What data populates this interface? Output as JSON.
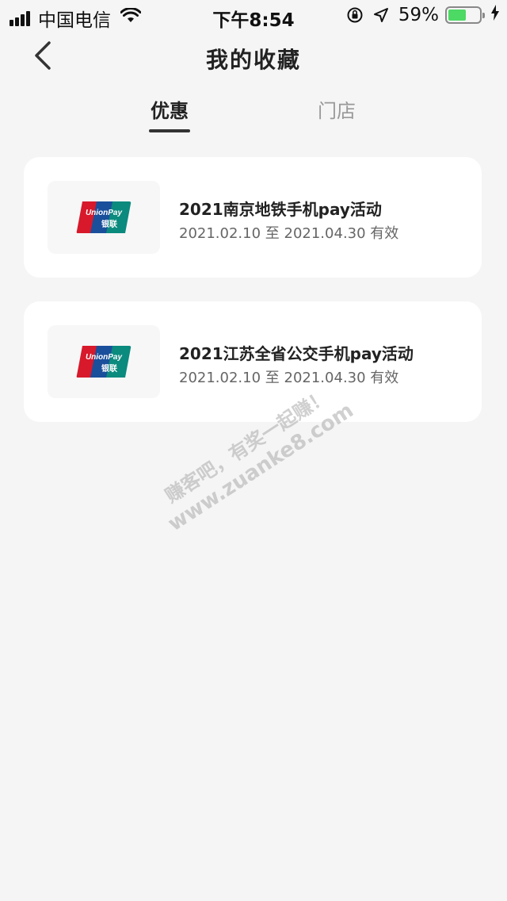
{
  "status_bar": {
    "carrier": "中国电信",
    "time": "下午8:54",
    "battery_percent": "59%",
    "battery_level": 0.59,
    "icons": [
      "signal-icon",
      "wifi-icon",
      "orientation-lock-icon",
      "location-icon",
      "battery-icon",
      "charging-icon"
    ]
  },
  "nav": {
    "title": "我的收藏",
    "back_icon": "chevron-left-icon"
  },
  "tabs": [
    {
      "label": "优惠",
      "active": true
    },
    {
      "label": "门店",
      "active": false
    }
  ],
  "cards": [
    {
      "title": "2021南京地铁手机pay活动",
      "validity": "2021.02.10 至 2021.04.30 有效",
      "logo": "unionpay-logo"
    },
    {
      "title": "2021江苏全省公交手机pay活动",
      "validity": "2021.02.10 至 2021.04.30 有效",
      "logo": "unionpay-logo"
    }
  ],
  "watermark": {
    "line1": "赚客吧，有奖一起赚！",
    "line2": "www.zuanke8.com"
  },
  "colors": {
    "background": "#f5f5f5",
    "card": "#ffffff",
    "battery_fill": "#4cd964",
    "unionpay_red": "#d7192b",
    "unionpay_blue": "#1a4f9c",
    "unionpay_green": "#0b8a7e"
  }
}
